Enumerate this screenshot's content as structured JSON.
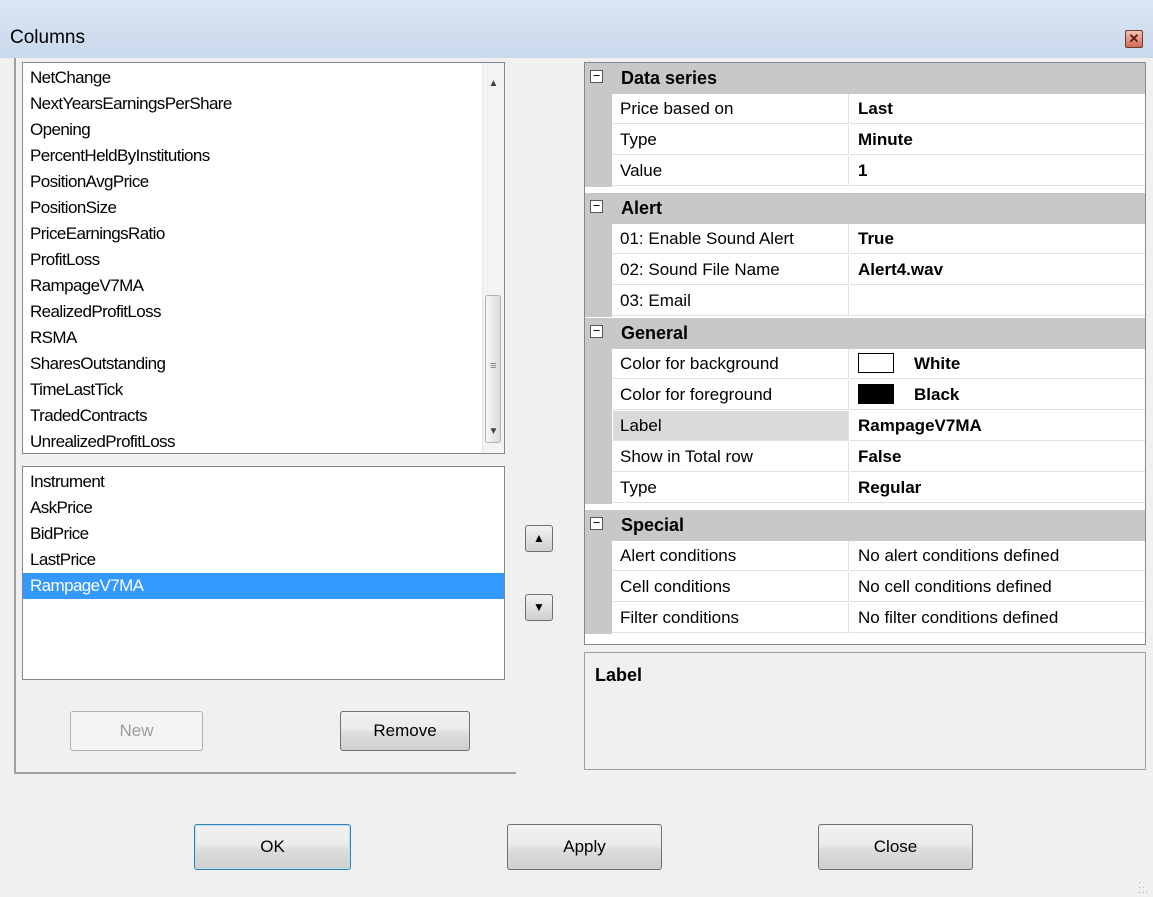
{
  "window": {
    "title": "Columns",
    "close_icon": "close-icon"
  },
  "available_columns": {
    "items": [
      "NetChange",
      "NextYearsEarningsPerShare",
      "Opening",
      "PercentHeldByInstitutions",
      "PositionAvgPrice",
      "PositionSize",
      "PriceEarningsRatio",
      "ProfitLoss",
      "RampageV7MA",
      "RealizedProfitLoss",
      "RSMA",
      "SharesOutstanding",
      "TimeLastTick",
      "TradedContracts",
      "UnrealizedProfitLoss"
    ]
  },
  "selected_columns": {
    "items": [
      "Instrument",
      "AskPrice",
      "BidPrice",
      "LastPrice",
      "RampageV7MA"
    ],
    "selected": "RampageV7MA"
  },
  "buttons": {
    "new": "New",
    "remove": "Remove",
    "ok": "OK",
    "apply": "Apply",
    "close": "Close"
  },
  "properties": {
    "data_series": {
      "title": "Data series",
      "rows": [
        {
          "name": "Price based on",
          "value": "Last"
        },
        {
          "name": "Type",
          "value": "Minute"
        },
        {
          "name": "Value",
          "value": "1"
        }
      ]
    },
    "alert": {
      "title": "Alert",
      "rows": [
        {
          "name": "01: Enable Sound Alert",
          "value": "True"
        },
        {
          "name": "02: Sound File Name",
          "value": "Alert4.wav"
        },
        {
          "name": "03: Email",
          "value": ""
        }
      ]
    },
    "general": {
      "title": "General",
      "rows": [
        {
          "name": "Color for background",
          "value": "White",
          "color": "#ffffff"
        },
        {
          "name": "Color for foreground",
          "value": "Black",
          "color": "#000000"
        },
        {
          "name": "Label",
          "value": "RampageV7MA"
        },
        {
          "name": "Show in Total row",
          "value": "False"
        },
        {
          "name": "Type",
          "value": "Regular"
        }
      ]
    },
    "special": {
      "title": "Special",
      "rows": [
        {
          "name": "Alert conditions",
          "value": "No alert conditions defined"
        },
        {
          "name": "Cell conditions",
          "value": "No cell conditions defined"
        },
        {
          "name": "Filter conditions",
          "value": "No filter conditions defined"
        }
      ]
    }
  },
  "help": {
    "title": "Label"
  },
  "colors": {
    "selection": "#3399ff",
    "category_bg": "#c8c8c8"
  }
}
